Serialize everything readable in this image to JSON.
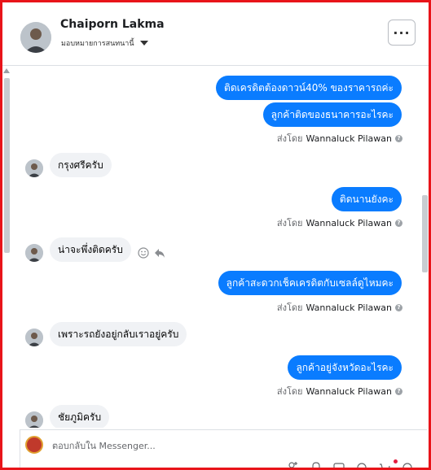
{
  "header": {
    "contact_name": "Chaiporn Lakma",
    "assign_label": "มอบหมายการสนทนานี้",
    "more_label": "···"
  },
  "messages": [
    {
      "dir": "out",
      "text": "ติดเครดิตต้องดาวน์40% ของราคารถค่ะ"
    },
    {
      "dir": "out",
      "text": "ลูกค้าติดของธนาคารอะไรคะ",
      "sent_prefix": "ส่งโดย",
      "sent_by": "Wannaluck Pilawan"
    },
    {
      "dir": "in",
      "text": "กรุงศรีครับ"
    },
    {
      "dir": "out",
      "text": "ติดนานยังคะ",
      "sent_prefix": "ส่งโดย",
      "sent_by": "Wannaluck Pilawan"
    },
    {
      "dir": "in",
      "text": "น่าจะพึ่งติดครับ"
    },
    {
      "dir": "out",
      "text": "ลูกค้าสะดวกเช็คเครดิตกับเซลล์ดูไหมคะ",
      "sent_prefix": "ส่งโดย",
      "sent_by": "Wannaluck Pilawan"
    },
    {
      "dir": "in",
      "text": "เพราะรถยังอยู่กลับเราอยู่ครับ"
    },
    {
      "dir": "out",
      "text": "ลูกค้าอยู่จังหวัดอะไรคะ",
      "sent_prefix": "ส่งโดย",
      "sent_by": "Wannaluck Pilawan"
    },
    {
      "dir": "in",
      "text": "ชัยภูมิครับ"
    }
  ],
  "composer": {
    "placeholder": "ตอบกลับใน Messenger..."
  },
  "icons": {
    "help": "?",
    "more": "more-icon",
    "emoji": "smiley-icon",
    "reply": "reply-icon"
  },
  "colors": {
    "outgoing_bubble": "#0a7cff",
    "incoming_bubble": "#f0f2f5",
    "frame": "#e8141a"
  }
}
